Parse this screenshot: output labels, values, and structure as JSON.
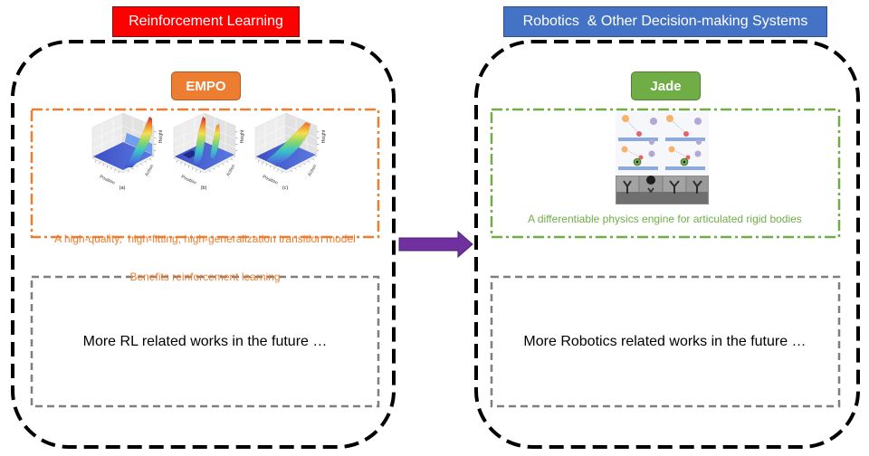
{
  "left_panel": {
    "title": "Reinforcement Learning",
    "title_color": "#ff0000",
    "project": {
      "name": "EMPO",
      "color": "#ed7d31",
      "figure": {
        "panels": [
          "(a)",
          "(b)",
          "(c)"
        ],
        "x_label": "Position",
        "y_label": "Action",
        "z_label": "Height"
      },
      "description": [
        "A high-quality,  high-fitting, high-generalization transition model",
        "Benefits reinforcement learning"
      ]
    },
    "future_note": "More RL related works in the future …",
    "future_frame_color": "#7f7f7f"
  },
  "arrow_color": "#7030a0",
  "right_panel": {
    "title": "Robotics  & Other Decision-making Systems",
    "title_color": "#4472c4",
    "project": {
      "name": "Jade",
      "color": "#70ad47",
      "description": "A differentiable physics engine for articulated rigid bodies"
    },
    "future_note": "More Robotics related works in the future …",
    "future_frame_color": "#7f7f7f"
  }
}
